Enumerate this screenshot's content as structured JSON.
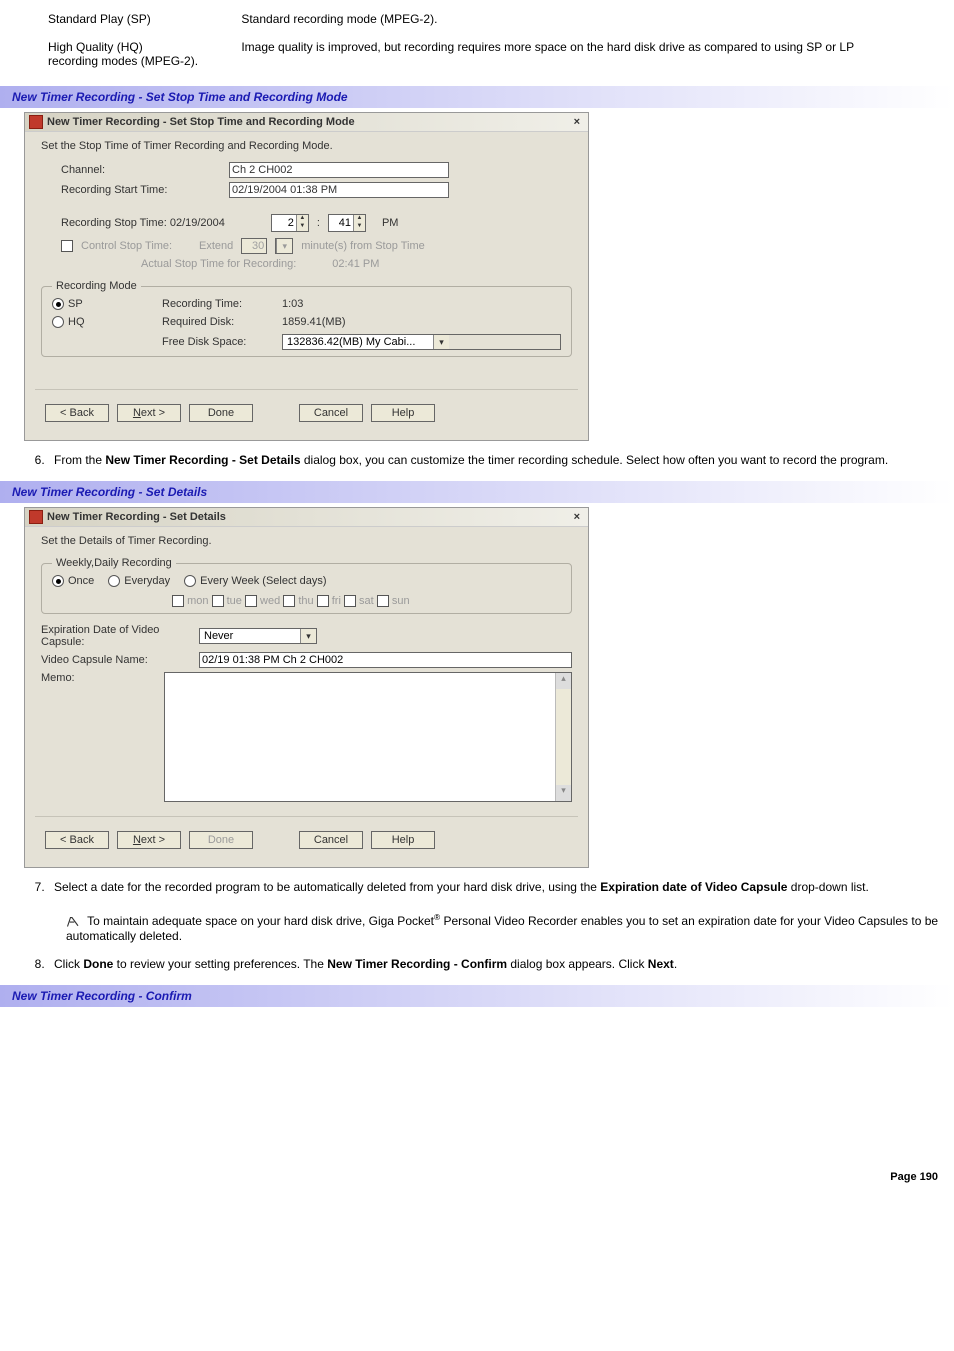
{
  "defs": {
    "sp_term": "Standard Play (SP)",
    "sp_desc": "Standard recording mode (MPEG-2).",
    "hq_term": "High Quality (HQ)",
    "hq_desc": "Image quality is improved, but recording requires more space on the hard disk drive as compared to using SP or LP recording modes (MPEG-2)."
  },
  "section1_title": "New Timer Recording - Set Stop Time and Recording Mode",
  "dlg1": {
    "title": "New Timer Recording - Set Stop Time and Recording Mode",
    "close": "×",
    "instr": "Set the Stop Time of Timer Recording and Recording Mode.",
    "channel_label": "Channel:",
    "channel_value": "Ch 2 CH002",
    "start_label": "Recording Start Time:",
    "start_value": "02/19/2004 01:38 PM",
    "stop_label": "Recording Stop Time: 02/19/2004",
    "stop_hour": "2",
    "stop_colon": ":",
    "stop_min": "41",
    "ampm": "PM",
    "ctrl_stop_label": "Control Stop Time:",
    "extend_label": "Extend",
    "extend_val": "30",
    "extend_unit": "minute(s) from Stop Time",
    "actual_label": "Actual Stop Time for Recording:",
    "actual_value": "02:41 PM",
    "recmode_legend": "Recording Mode",
    "sp_label": "SP",
    "hq_label": "HQ",
    "rec_time_label": "Recording Time:",
    "rec_time_val": "1:03",
    "req_disk_label": "Required Disk:",
    "req_disk_val": "1859.41(MB)",
    "free_disk_label": "Free Disk Space:",
    "free_disk_val": "132836.42(MB) My Cabi...",
    "back": "< Back",
    "next": "Next >",
    "done": "Done",
    "cancel": "Cancel",
    "help": "Help"
  },
  "item6_a": "From the ",
  "item6_b": "New Timer Recording - Set Details",
  "item6_c": " dialog box, you can customize the timer recording schedule. Select how often you want to record the program.",
  "section2_title": "New Timer Recording - Set Details",
  "dlg2": {
    "title": "New Timer Recording - Set Details",
    "close": "×",
    "instr": "Set the Details of Timer Recording.",
    "wk_legend": "Weekly,Daily Recording",
    "once": "Once",
    "everyday": "Everyday",
    "everyweek": "Every Week (Select days)",
    "mon": "mon",
    "tue": "tue",
    "wed": "wed",
    "thu": "thu",
    "fri": "fri",
    "sat": "sat",
    "sun": "sun",
    "exp_label": "Expiration Date of Video Capsule:",
    "exp_val": "Never",
    "name_label": "Video Capsule Name:",
    "name_val": "02/19 01:38 PM Ch 2 CH002",
    "memo_label": "Memo:",
    "back": "< Back",
    "next": "Next >",
    "done": "Done",
    "cancel": "Cancel",
    "help": "Help"
  },
  "item7_a": "Select a date for the recorded program to be automatically deleted from your hard disk drive, using the ",
  "item7_b": "Expiration date of Video Capsule",
  "item7_c": " drop-down list.",
  "note_a": " To maintain adequate space on your hard disk drive, Giga Pocket",
  "note_reg": "®",
  "note_b": " Personal Video Recorder enables you to set an expiration date for your Video Capsules to be automatically deleted.",
  "item8_a": "Click ",
  "item8_b": "Done",
  "item8_c": " to review your setting preferences. The ",
  "item8_d": "New Timer Recording - Confirm",
  "item8_e": " dialog box appears. Click ",
  "item8_f": "Next",
  "item8_g": ".",
  "section3_title": "New Timer Recording - Confirm",
  "page_footer": "Page 190"
}
